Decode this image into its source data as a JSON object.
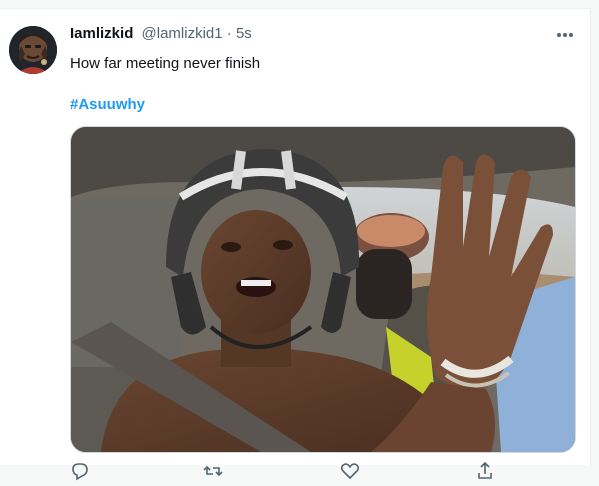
{
  "tweet": {
    "display_name": "Iamlizkid",
    "handle": "@lamlizkid1",
    "separator": "·",
    "time": "5s",
    "text": "How far meeting never finish",
    "hashtag": "#Asuuwhy",
    "media_description_icon": "video-still"
  },
  "icons": {
    "more": "more-icon",
    "reply": "reply-icon",
    "retweet": "retweet-icon",
    "like": "like-icon",
    "share": "share-icon"
  },
  "colors": {
    "accent": "#1d9bf0",
    "text_primary": "#0f1419",
    "text_secondary": "#536471"
  }
}
